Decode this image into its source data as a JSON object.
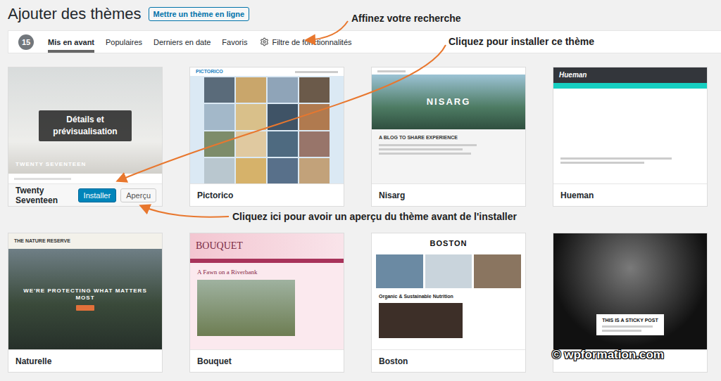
{
  "header": {
    "title": "Ajouter des thèmes",
    "upload_button": "Mettre un thème en ligne"
  },
  "filter_bar": {
    "count": "15",
    "tabs": [
      {
        "label": "Mis en avant",
        "selected": true
      },
      {
        "label": "Populaires",
        "selected": false
      },
      {
        "label": "Derniers en date",
        "selected": false
      },
      {
        "label": "Favoris",
        "selected": false
      }
    ],
    "feature_filter": "Filtre de fonctionnalités"
  },
  "themes": [
    {
      "name": "Twenty Seventeen",
      "hovered": true,
      "overlay": "Détails et prévisualisation",
      "buttons": {
        "install": "Installer",
        "preview": "Aperçu"
      },
      "preview": {
        "kind": "twentyseventeen",
        "title": "TWENTY SEVENTEEN"
      }
    },
    {
      "name": "Pictorico",
      "hovered": false,
      "preview": {
        "kind": "pictorico",
        "title": "PICTORICO"
      }
    },
    {
      "name": "Nisarg",
      "hovered": false,
      "preview": {
        "kind": "nisarg",
        "title": "NISARG",
        "headline": "A BLOG TO SHARE EXPERIENCE"
      }
    },
    {
      "name": "Hueman",
      "hovered": false,
      "preview": {
        "kind": "hueman",
        "title": "Hueman"
      }
    },
    {
      "name": "Naturelle",
      "hovered": false,
      "preview": {
        "kind": "naturelle",
        "title": "THE NATURE RESERVE",
        "headline": "WE'RE PROTECTING WHAT MATTERS MOST"
      }
    },
    {
      "name": "Bouquet",
      "hovered": false,
      "preview": {
        "kind": "bouquet",
        "title": "BOUQUET",
        "headline": "A Fawn on a Riverbank"
      }
    },
    {
      "name": "Boston",
      "hovered": false,
      "preview": {
        "kind": "boston",
        "title": "BOSTON",
        "headline": "Organic & Sustainable Nutrition"
      }
    },
    {
      "name": "",
      "hovered": false,
      "preview": {
        "kind": "sticky",
        "headline": "THIS IS A STICKY POST"
      }
    }
  ],
  "annotations": [
    {
      "text": "Affinez votre recherche"
    },
    {
      "text": "Cliquez pour installer ce thème"
    },
    {
      "text": "Cliquez ici pour avoir un aperçu du thème avant de l'installer"
    }
  ],
  "watermark": "© wpformation.com"
}
